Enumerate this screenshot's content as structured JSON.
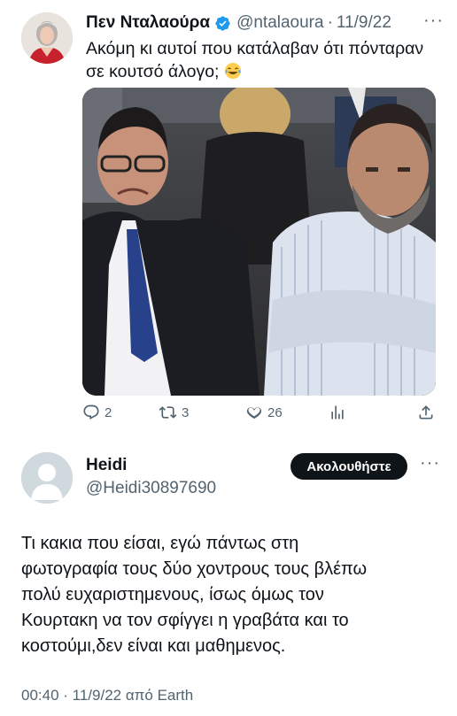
{
  "tweet": {
    "author_name": "Πεν Νταλαούρα",
    "handle": "@ntalaoura",
    "separator": "·",
    "date": "11/9/22",
    "text_lines": [
      "Ακόμη κι αυτοί που κατάλαβαν ότι πόνταραν",
      "σε κουτσό άλογο;"
    ],
    "emoji": "face-with-tears-of-joy-icon",
    "actions": {
      "replies": "2",
      "retweets": "3",
      "likes": "26"
    }
  },
  "reply": {
    "author_name": "Heidi",
    "handle": "@Heidi30897690",
    "follow_label": "Ακολουθήστε",
    "text_lines": [
      "Τι κακια που είσαι, εγώ πάντως στη",
      "φωτογραφία τους δύο χοντρους τους βλέπω",
      "πολύ ευχαριστημενους, ίσως όμως τον",
      "Κουρτακη να τον σφίγγει η γραβάτα και το",
      "κοστούμι,δεν είναι και μαθημενος."
    ],
    "timestamp": "00:40 · 11/9/22 από Earth"
  },
  "colors": {
    "verified_blue": "#1d9bf0",
    "muted_text": "#536471",
    "follow_button_bg": "#0f1419"
  }
}
